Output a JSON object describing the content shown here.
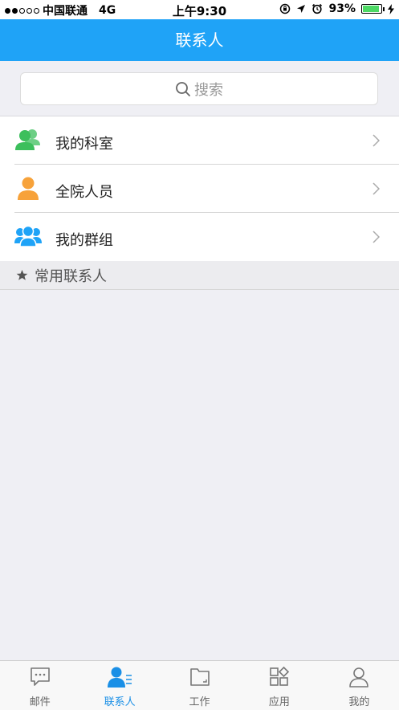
{
  "status_bar": {
    "signal_dots": [
      true,
      true,
      false,
      false,
      false
    ],
    "carrier": "中国联通",
    "network": "4G",
    "time": "上午9:30",
    "battery": "93%",
    "battery_level": 0.93
  },
  "navbar": {
    "title": "联系人"
  },
  "search": {
    "placeholder": "搜索"
  },
  "rows": [
    {
      "label": "我的科室",
      "icon": "department-icon",
      "color": "#3cbf5c"
    },
    {
      "label": "全院人员",
      "icon": "person-icon",
      "color": "#f7a23a"
    },
    {
      "label": "我的群组",
      "icon": "group-icon",
      "color": "#1fa3f7"
    }
  ],
  "section": {
    "title": "常用联系人"
  },
  "tabs": [
    {
      "label": "邮件",
      "icon": "mail-icon",
      "active": false
    },
    {
      "label": "联系人",
      "icon": "contacts-icon",
      "active": true
    },
    {
      "label": "工作",
      "icon": "folder-icon",
      "active": false
    },
    {
      "label": "应用",
      "icon": "apps-icon",
      "active": false
    },
    {
      "label": "我的",
      "icon": "profile-icon",
      "active": false
    }
  ],
  "colors": {
    "accent": "#1fa3f7",
    "active_tab": "#1a8fe6"
  }
}
